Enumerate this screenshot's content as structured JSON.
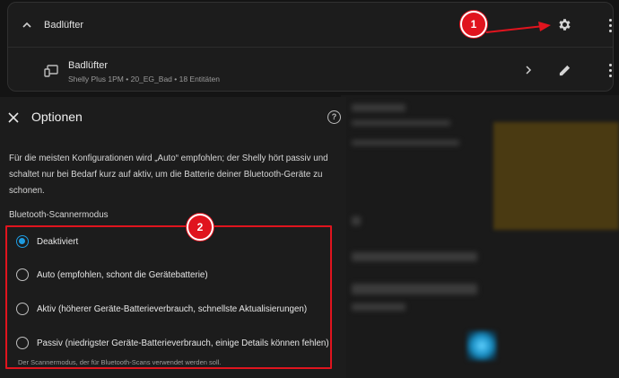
{
  "device_card": {
    "header_title": "Badlüfter",
    "device": {
      "name": "Badlüfter",
      "subtitle": "Shelly Plus 1PM • 20_EG_Bad • 18 Entitäten"
    }
  },
  "options": {
    "title": "Optionen",
    "description": "Für die meisten Konfigurationen wird „Auto“ empfohlen; der Shelly hört passiv und schaltet nur bei Bedarf kurz auf aktiv, um die Batterie deiner Bluetooth-Geräte zu schonen.",
    "mode_label": "Bluetooth-Scannermodus",
    "radio_options": [
      {
        "label": "Deaktiviert",
        "checked": true
      },
      {
        "label": "Auto (empfohlen, schont die Gerätebatterie)",
        "checked": false
      },
      {
        "label": "Aktiv (höherer Geräte-Batterieverbrauch, schnellste Aktualisierungen)",
        "checked": false
      },
      {
        "label": "Passiv (niedrigster Geräte-Batterieverbrauch, einige Details können fehlen)",
        "checked": false
      }
    ],
    "helper_text": "Der Scannermodus, der für Bluetooth-Scans verwendet werden soll."
  },
  "annotations": {
    "marker_1": "1",
    "marker_2": "2",
    "highlight_color": "#e0141e"
  },
  "colors": {
    "accent": "#1e9be0",
    "background": "#141414",
    "card": "#1c1c1c"
  },
  "icons": [
    "chevron-up-icon",
    "gear-icon",
    "more-vert-icon",
    "device-icon",
    "chevron-right-icon",
    "pencil-icon",
    "close-icon",
    "help-icon"
  ]
}
